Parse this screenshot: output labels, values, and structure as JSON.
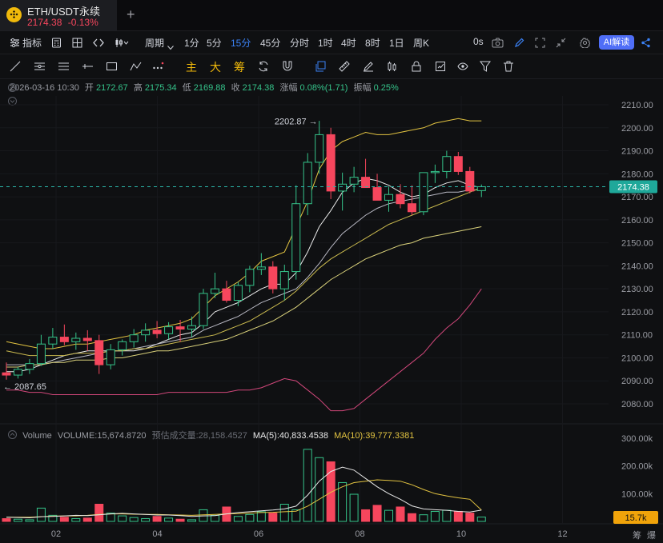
{
  "tab": {
    "symbol": "ETH/USDT永续",
    "price": "2174.38",
    "change": "-0.13%",
    "add_label": "+"
  },
  "toolbar": {
    "indicators_label": "指标",
    "period_label": "周期",
    "timeframes": [
      "1分",
      "5分",
      "15分",
      "45分",
      "分时",
      "1时",
      "4时",
      "8时",
      "1日",
      "周K"
    ],
    "active_timeframe": "15分",
    "seconds_label": "0s",
    "ai_label": "AI解读"
  },
  "drawing_tools": {
    "chinese_buttons": [
      "主",
      "大",
      "筹"
    ]
  },
  "ohlc": {
    "datetime": "2026-03-16 10:30",
    "open_label": "开",
    "open": "2172.67",
    "high_label": "高",
    "high": "2175.34",
    "low_label": "低",
    "low": "2169.88",
    "close_label": "收",
    "close": "2174.38",
    "change_label": "涨幅",
    "change": "0.08%(1.71)",
    "amplitude_label": "振幅",
    "amplitude": "0.25%"
  },
  "volume_legend": {
    "title": "Volume",
    "volume": "VOLUME:15,674.8720",
    "estimated": "预估成交量:28,158.4527",
    "ma5": "MA(5):40,833.4538",
    "ma10": "MA(10):39,777.3381"
  },
  "price_axis": [
    "2210.00",
    "2200.00",
    "2190.00",
    "2180.00",
    "2170.00",
    "2160.00",
    "2150.00",
    "2140.00",
    "2130.00",
    "2120.00",
    "2110.00",
    "2100.00",
    "2090.00",
    "2080.00"
  ],
  "current_price_tag": "2174.38",
  "high_annotation": "2202.87 →",
  "low_annotation": "← 2087.65",
  "volume_axis": [
    "300.00k",
    "200.00k",
    "100.00k"
  ],
  "volume_tag": "15.7k",
  "time_axis": [
    "02",
    "04",
    "06",
    "08",
    "10",
    "12"
  ],
  "corner_labels": [
    "筹",
    "爆"
  ],
  "colors": {
    "up": "#35c38a",
    "down": "#f6465d",
    "accent": "#3b82f6",
    "ai": "#4f6ef7",
    "brand": "#f0b90b"
  },
  "chart_data": {
    "type": "candlestick",
    "ylim": [
      2075,
      2215
    ],
    "candles": [
      [
        2093.5,
        2098.0,
        2090.5,
        2092.5
      ],
      [
        2092.5,
        2096.0,
        2091.0,
        2095.0
      ],
      [
        2095.0,
        2099.5,
        2093.0,
        2097.5
      ],
      [
        2097.5,
        2110.0,
        2096.5,
        2106.0
      ],
      [
        2106.0,
        2113.0,
        2104.0,
        2109.0
      ],
      [
        2109.0,
        2114.5,
        2105.5,
        2107.0
      ],
      [
        2107.0,
        2111.0,
        2103.5,
        2108.5
      ],
      [
        2108.5,
        2112.0,
        2103.0,
        2107.5
      ],
      [
        2107.5,
        2110.0,
        2093.0,
        2097.0
      ],
      [
        2097.0,
        2106.0,
        2095.0,
        2103.5
      ],
      [
        2103.5,
        2108.0,
        2101.0,
        2107.0
      ],
      [
        2107.0,
        2112.5,
        2104.5,
        2110.0
      ],
      [
        2110.0,
        2115.0,
        2107.0,
        2112.0
      ],
      [
        2112.0,
        2116.0,
        2108.5,
        2110.5
      ],
      [
        2110.5,
        2115.5,
        2108.0,
        2113.5
      ],
      [
        2113.5,
        2116.5,
        2107.0,
        2112.5
      ],
      [
        2112.5,
        2118.0,
        2109.0,
        2114.0
      ],
      [
        2114.0,
        2130.0,
        2112.5,
        2128.0
      ],
      [
        2128.0,
        2137.0,
        2126.0,
        2130.0
      ],
      [
        2130.0,
        2133.5,
        2124.0,
        2125.0
      ],
      [
        2125.0,
        2133.0,
        2122.5,
        2131.5
      ],
      [
        2131.5,
        2140.0,
        2128.5,
        2138.5
      ],
      [
        2138.5,
        2145.5,
        2136.0,
        2139.5
      ],
      [
        2139.5,
        2142.0,
        2128.0,
        2130.0
      ],
      [
        2130.0,
        2140.5,
        2125.0,
        2137.5
      ],
      [
        2137.5,
        2175.0,
        2134.0,
        2167.0
      ],
      [
        2167.0,
        2189.0,
        2162.0,
        2185.0
      ],
      [
        2185.0,
        2203.0,
        2180.0,
        2197.0
      ],
      [
        2197.0,
        2200.0,
        2169.0,
        2172.5
      ],
      [
        2172.5,
        2180.5,
        2164.0,
        2175.5
      ],
      [
        2175.5,
        2183.0,
        2172.0,
        2178.5
      ],
      [
        2178.5,
        2186.5,
        2174.5,
        2174.0
      ],
      [
        2174.0,
        2180.0,
        2168.5,
        2168.5
      ],
      [
        2168.5,
        2174.5,
        2163.5,
        2171.0
      ],
      [
        2171.0,
        2175.5,
        2165.0,
        2167.0
      ],
      [
        2167.0,
        2175.0,
        2162.0,
        2163.5
      ],
      [
        2163.5,
        2176.0,
        2162.0,
        2180.5
      ],
      [
        2180.5,
        2184.0,
        2176.0,
        2181.0
      ],
      [
        2181.0,
        2190.0,
        2178.0,
        2187.5
      ],
      [
        2187.5,
        2189.5,
        2179.5,
        2181.0
      ],
      [
        2181.0,
        2183.0,
        2171.5,
        2172.5
      ],
      [
        2172.67,
        2175.34,
        2169.88,
        2174.38
      ]
    ],
    "volumes": [
      10,
      8,
      6,
      48,
      22,
      15,
      10,
      12,
      62,
      30,
      20,
      14,
      10,
      18,
      12,
      8,
      6,
      42,
      22,
      52,
      18,
      25,
      35,
      30,
      62,
      42,
      260,
      230,
      215,
      140,
      98,
      42,
      58,
      40,
      52,
      28,
      24,
      36,
      40,
      36,
      30,
      15.7
    ],
    "ma_lines": [
      {
        "color": "#e8e8e8",
        "values": [
          2094,
          2094,
          2095,
          2097,
          2099,
          2101,
          2102,
          2103,
          2103,
          2103,
          2103,
          2103,
          2104,
          2106,
          2108,
          2110,
          2111,
          2115,
          2120,
          2122,
          2124,
          2127,
          2130,
          2132,
          2132,
          2137,
          2146,
          2157,
          2164,
          2172,
          2176,
          2178,
          2177,
          2175,
          2172,
          2170,
          2171,
          2174,
          2176,
          2177,
          2175,
          2174
        ]
      },
      {
        "color": "#b9b9c4",
        "values": [
          2097,
          2097,
          2097,
          2097,
          2098,
          2099,
          2100,
          2101,
          2102,
          2103,
          2103,
          2104,
          2105,
          2106,
          2107,
          2108,
          2109,
          2112,
          2114,
          2116,
          2118,
          2121,
          2124,
          2126,
          2128,
          2130,
          2135,
          2141,
          2148,
          2154,
          2158,
          2162,
          2165,
          2167,
          2168,
          2169,
          2170,
          2171,
          2172,
          2172,
          2173,
          2173
        ]
      },
      {
        "color": "#e2c341",
        "values": [
          2107,
          2106,
          2105,
          2104,
          2104,
          2105,
          2106,
          2106,
          2107,
          2108,
          2109,
          2110,
          2112,
          2113,
          2114,
          2115,
          2117,
          2122,
          2127,
          2130,
          2133,
          2137,
          2142,
          2144,
          2146,
          2157,
          2168,
          2182,
          2190,
          2194,
          2196,
          2198,
          2197,
          2197,
          2198,
          2199,
          2200,
          2202,
          2203,
          2204,
          2203,
          2203
        ]
      },
      {
        "color": "#c9b94e",
        "values": [
          2103,
          2102,
          2101,
          2101,
          2101,
          2101,
          2102,
          2102,
          2102,
          2103,
          2103,
          2104,
          2104,
          2105,
          2106,
          2107,
          2108,
          2109,
          2110,
          2112,
          2114,
          2116,
          2119,
          2122,
          2125,
          2129,
          2134,
          2139,
          2143,
          2146,
          2149,
          2152,
          2155,
          2158,
          2160,
          2162,
          2164,
          2166,
          2168,
          2170,
          2172,
          2174
        ]
      },
      {
        "color": "#d8d07a",
        "values": [
          2096,
          2096,
          2097,
          2097,
          2098,
          2098,
          2099,
          2099,
          2099,
          2100,
          2100,
          2101,
          2102,
          2103,
          2103,
          2104,
          2105,
          2106,
          2107,
          2108,
          2110,
          2112,
          2114,
          2116,
          2119,
          2122,
          2126,
          2130,
          2134,
          2137,
          2140,
          2143,
          2145,
          2147,
          2149,
          2150,
          2152,
          2153,
          2154,
          2155,
          2156,
          2157
        ]
      },
      {
        "color": "#d0477a",
        "values": [
          2086,
          2086,
          2085,
          2085,
          2084,
          2084,
          2084,
          2084,
          2084,
          2084,
          2084,
          2084,
          2084,
          2084,
          2085,
          2085,
          2085,
          2085,
          2085,
          2085,
          2086,
          2086,
          2087,
          2089,
          2091,
          2090,
          2086,
          2082,
          2077,
          2077,
          2078,
          2082,
          2086,
          2090,
          2094,
          2098,
          2102,
          2108,
          2113,
          2117,
          2123,
          2130
        ]
      }
    ],
    "vol_ma": [
      {
        "color": "#e2c341",
        "values": [
          15,
          15,
          15,
          17,
          19,
          20,
          20,
          22,
          25,
          27,
          27,
          26,
          25,
          25,
          24,
          23,
          22,
          24,
          25,
          27,
          28,
          30,
          32,
          33,
          35,
          37,
          55,
          80,
          105,
          125,
          140,
          145,
          150,
          148,
          145,
          132,
          115,
          100,
          92,
          85,
          80,
          41
        ]
      },
      {
        "color": "#e8e8e8",
        "values": [
          15,
          14,
          13,
          17,
          18,
          20,
          22,
          21,
          24,
          27,
          29,
          27,
          25,
          23,
          23,
          21,
          18,
          20,
          21,
          27,
          32,
          35,
          38,
          41,
          45,
          55,
          95,
          145,
          180,
          196,
          185,
          155,
          125,
          100,
          80,
          56,
          45,
          42,
          40,
          36,
          34,
          40.8
        ]
      }
    ],
    "x_ticks": [
      "02",
      "04",
      "06",
      "08",
      "10",
      "12"
    ],
    "high_marker": 2202.87,
    "low_marker": 2087.65,
    "current_price": 2174.38
  }
}
